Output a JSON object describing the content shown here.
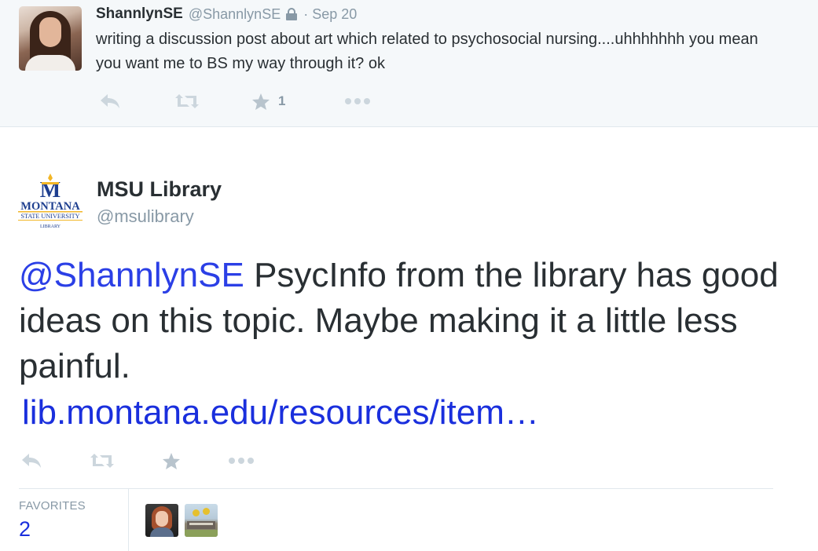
{
  "parent_tweet": {
    "display_name": "ShannlynSE",
    "handle": "@ShannlynSE",
    "separator": "·",
    "timestamp": "Sep 20",
    "protected_icon": "lock-icon",
    "text": "writing a discussion post about art which related to psychosocial nursing....uhhhhhhh you mean you want me to BS my way through it? ok",
    "actions": {
      "reply_icon": "reply-icon",
      "retweet_icon": "retweet-icon",
      "favorite_icon": "star-icon",
      "favorite_count": "1",
      "more_icon": "more-dots-icon"
    }
  },
  "main_tweet": {
    "display_name": "MSU Library",
    "handle": "@msulibrary",
    "logo": {
      "letter": "M",
      "line1": "MONTANA",
      "line2": "STATE UNIVERSITY",
      "line3": "LIBRARY"
    },
    "mention": "@ShannlynSE",
    "text": " PsycInfo from the library has good ideas on this topic. Maybe making it a little less painful.",
    "link": "lib.montana.edu/resources/item…",
    "actions": {
      "reply_icon": "reply-icon",
      "retweet_icon": "retweet-icon",
      "favorite_icon": "star-icon",
      "more_icon": "more-dots-icon"
    },
    "stats": {
      "favorites_label": "FAVORITES",
      "favorites_value": "2"
    }
  },
  "colors": {
    "link_blue": "#1a2fdd",
    "gray_text": "#8899a6",
    "parent_bg": "#f5f8fa",
    "msu_blue": "#1e3f8f",
    "msu_gold": "#f2b626"
  }
}
